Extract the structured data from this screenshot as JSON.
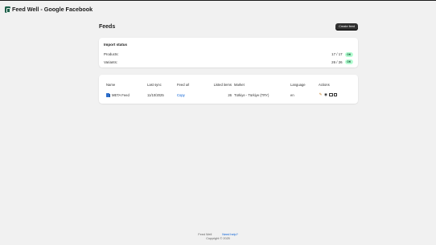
{
  "app": {
    "title": "Feed Well - Google Facebook",
    "logo_icon": "app-logo-icon"
  },
  "page": {
    "title": "Feeds",
    "create_button": "Create feed"
  },
  "import_status": {
    "title": "Import status",
    "rows": [
      {
        "label": "Products:",
        "value": "17 / 17",
        "badge": "OK"
      },
      {
        "label": "Variants:",
        "value": "26 / 26",
        "badge": "OK"
      }
    ]
  },
  "feeds_table": {
    "headers": {
      "name": "Name",
      "last_sync": "Last sync",
      "feed_url": "Feed url",
      "listed_items": "Listed items",
      "market": "Market",
      "language": "Language",
      "actions": "Actions"
    },
    "rows": [
      {
        "name": "META Feed",
        "icon": "meta-feed-icon",
        "last_sync": "11/10/2025",
        "feed_url_link": "Copy",
        "listed_items": "26",
        "market": "Türkiye - Türkiye (TRY)",
        "language": "en",
        "actions": [
          "edit-icon",
          "view-icon",
          "download-icon",
          "delete-icon"
        ]
      }
    ]
  },
  "footer": {
    "app_link": "Feed Well",
    "help_link": "Need help?",
    "copyright": "Copyright © 2025"
  },
  "colors": {
    "background": "#f1f1f1",
    "primary_button": "#303030",
    "ok_badge_bg": "#b4fed2",
    "ok_badge_text": "#0c5132",
    "link": "#005bd3"
  }
}
